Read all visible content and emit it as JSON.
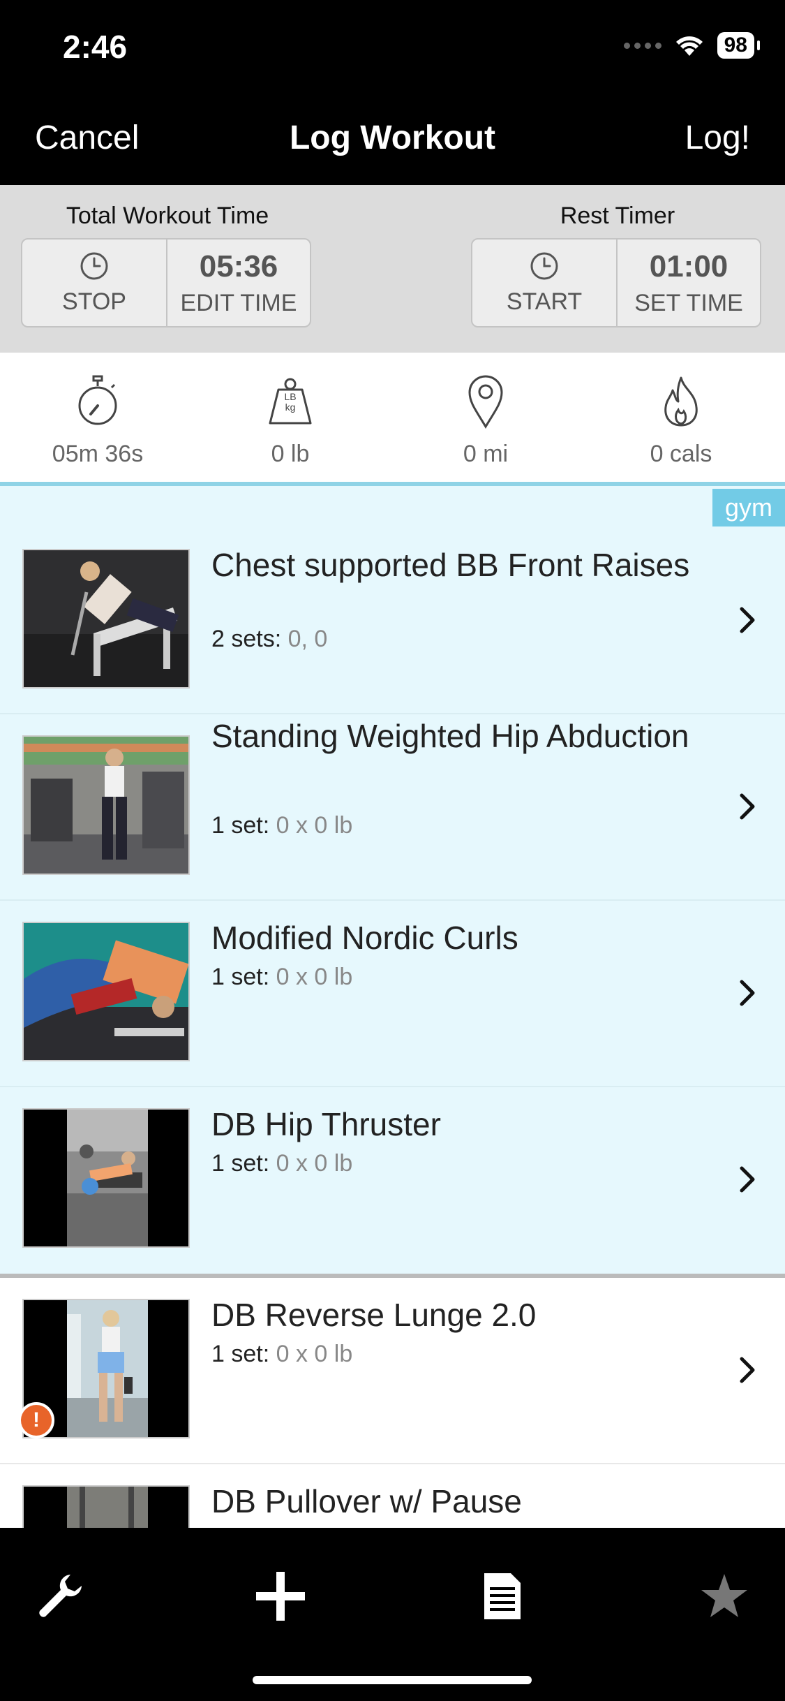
{
  "status_bar": {
    "time": "2:46",
    "battery": "98"
  },
  "nav": {
    "cancel": "Cancel",
    "title": "Log Workout",
    "log": "Log!"
  },
  "timers": {
    "total": {
      "label": "Total Workout Time",
      "stop": "STOP",
      "time": "05:36",
      "edit": "EDIT TIME"
    },
    "rest": {
      "label": "Rest Timer",
      "start": "START",
      "time": "01:00",
      "set": "SET TIME"
    }
  },
  "stats": [
    {
      "icon": "stopwatch-icon",
      "value": "05m 36s"
    },
    {
      "icon": "weight-icon",
      "value": "0 lb",
      "icon_text_top": "LB",
      "icon_text_bottom": "kg"
    },
    {
      "icon": "location-pin-icon",
      "value": "0 mi"
    },
    {
      "icon": "flame-icon",
      "value": "0 cals"
    }
  ],
  "group_tag": "gym",
  "exercises": [
    {
      "name": "Chest supported BB Front Raises",
      "sets_label": "2 sets:",
      "sets_value": "0, 0"
    },
    {
      "name": "Standing Weighted Hip Abduction",
      "sets_label": "1 set:",
      "sets_value": "0 x 0 lb"
    },
    {
      "name": "Modified Nordic Curls",
      "sets_label": "1 set:",
      "sets_value": "0 x 0 lb"
    },
    {
      "name": "DB Hip Thruster",
      "sets_label": "1 set:",
      "sets_value": "0 x 0 lb"
    },
    {
      "name": "DB Reverse Lunge 2.0",
      "sets_label": "1 set:",
      "sets_value": "0 x 0 lb",
      "alert": "!"
    },
    {
      "name": "DB Pullover w/ Pause"
    }
  ],
  "tabs": [
    "wrench-icon",
    "plus-icon",
    "document-icon",
    "star-icon"
  ],
  "colors": {
    "accent": "#72cbe6",
    "gym_bg": "#e6f8fd",
    "alert": "#e8642a"
  }
}
